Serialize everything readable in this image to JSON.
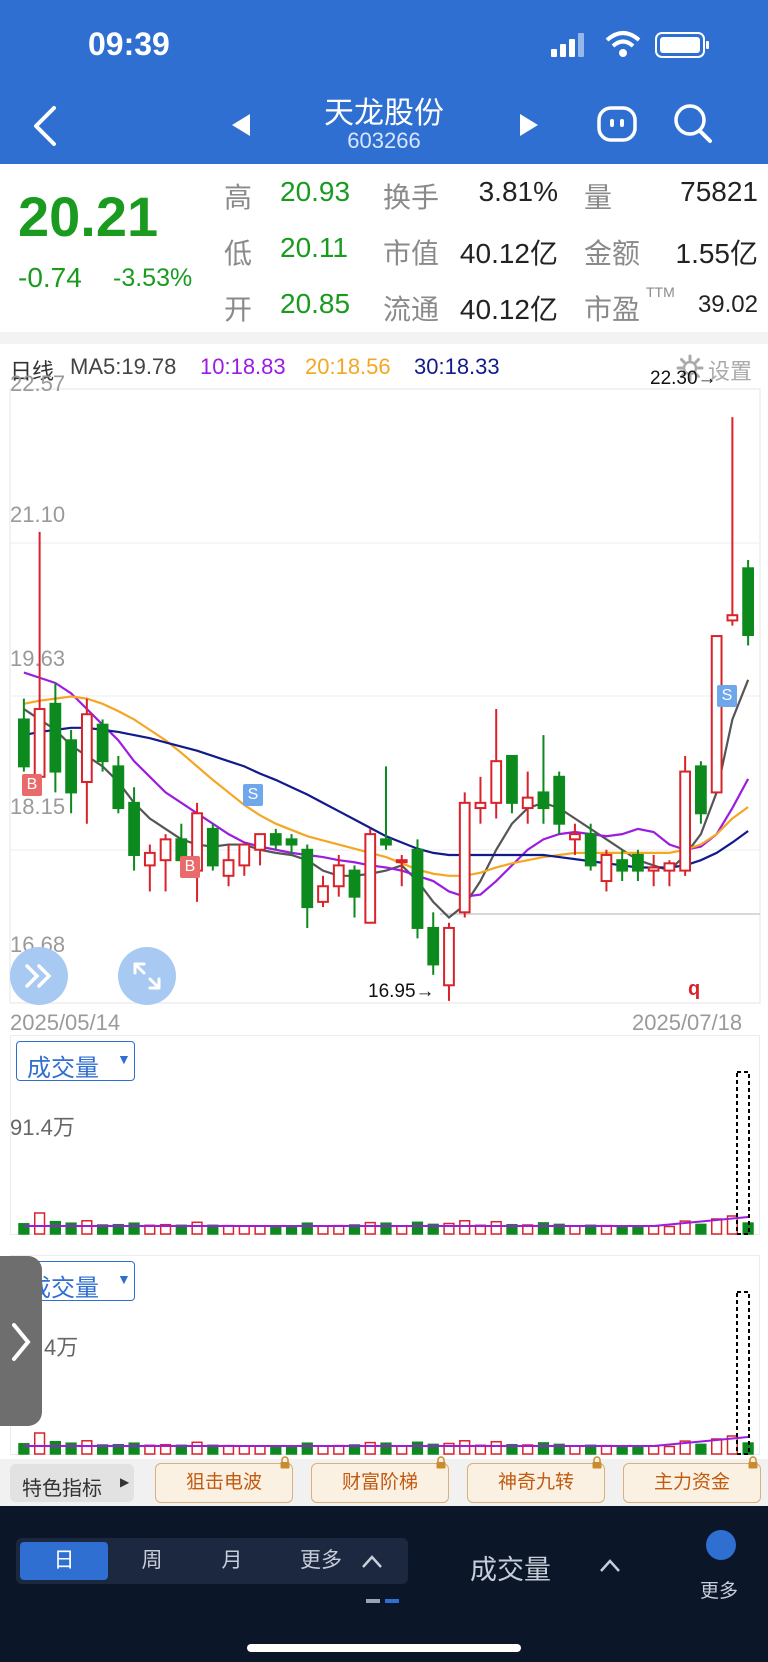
{
  "status": {
    "time": "09:39"
  },
  "nav": {
    "title": "天龙股份",
    "code": "603266"
  },
  "quote": {
    "price": "20.21",
    "change": "-0.74",
    "change_pct": "-3.53%",
    "labels": {
      "high": "高",
      "low": "低",
      "open": "开",
      "turnover": "换手",
      "mkt_cap": "市值",
      "float_cap": "流通",
      "volume": "量",
      "amount": "金额",
      "pe": "市盈",
      "ttm": "TTM"
    },
    "values": {
      "high": "20.93",
      "low": "20.11",
      "open": "20.85",
      "turnover": "3.81%",
      "mkt_cap": "40.12亿",
      "float_cap": "40.12亿",
      "volume": "75821",
      "amount": "1.55亿",
      "pe": "39.02"
    }
  },
  "kline": {
    "period_label": "日线",
    "ma5": "MA5:19.78",
    "ma10": "10:18.83",
    "ma20": "20:18.56",
    "ma30": "30:18.33",
    "settings": "设置",
    "y_labels": [
      "22.57",
      "21.10",
      "19.63",
      "18.15",
      "16.68"
    ],
    "max_label": "22.30→",
    "min_label": "16.95→",
    "q_marker": "q",
    "date_start": "2025/05/14",
    "date_end": "2025/07/18",
    "colors": {
      "up": "#d9222a",
      "down": "#0c8a1d",
      "ma5": "#555555",
      "ma10": "#9b1de0",
      "ma20": "#f5a623",
      "ma30": "#121a8c"
    },
    "signals": {
      "buy": "B",
      "sell": "S"
    }
  },
  "chart_data": {
    "type": "candlestick",
    "candles": [
      {
        "o": 19.4,
        "h": 19.6,
        "l": 18.9,
        "c": 18.95
      },
      {
        "o": 18.85,
        "h": 21.2,
        "l": 18.7,
        "c": 19.5
      },
      {
        "o": 19.55,
        "h": 19.75,
        "l": 18.7,
        "c": 18.9
      },
      {
        "o": 19.2,
        "h": 19.3,
        "l": 18.5,
        "c": 18.7
      },
      {
        "o": 18.8,
        "h": 19.6,
        "l": 18.4,
        "c": 19.45
      },
      {
        "o": 19.35,
        "h": 19.4,
        "l": 18.9,
        "c": 19.0
      },
      {
        "o": 18.95,
        "h": 19.05,
        "l": 18.5,
        "c": 18.55
      },
      {
        "o": 18.6,
        "h": 18.75,
        "l": 17.95,
        "c": 18.1
      },
      {
        "o": 18.0,
        "h": 18.2,
        "l": 17.75,
        "c": 18.12
      },
      {
        "o": 18.05,
        "h": 18.3,
        "l": 17.75,
        "c": 18.25
      },
      {
        "o": 18.25,
        "h": 18.4,
        "l": 17.95,
        "c": 18.05
      },
      {
        "o": 17.95,
        "h": 18.6,
        "l": 17.65,
        "c": 18.5
      },
      {
        "o": 18.35,
        "h": 18.4,
        "l": 17.95,
        "c": 18.0
      },
      {
        "o": 17.9,
        "h": 18.2,
        "l": 17.8,
        "c": 18.05
      },
      {
        "o": 18.0,
        "h": 18.2,
        "l": 17.9,
        "c": 18.2
      },
      {
        "o": 18.15,
        "h": 18.3,
        "l": 18.0,
        "c": 18.3
      },
      {
        "o": 18.3,
        "h": 18.35,
        "l": 18.15,
        "c": 18.2
      },
      {
        "o": 18.25,
        "h": 18.3,
        "l": 18.1,
        "c": 18.2
      },
      {
        "o": 18.15,
        "h": 18.2,
        "l": 17.4,
        "c": 17.6
      },
      {
        "o": 17.65,
        "h": 17.9,
        "l": 17.6,
        "c": 17.8
      },
      {
        "o": 17.8,
        "h": 18.1,
        "l": 17.7,
        "c": 18.0
      },
      {
        "o": 17.95,
        "h": 18.0,
        "l": 17.5,
        "c": 17.7
      },
      {
        "o": 17.45,
        "h": 18.35,
        "l": 17.45,
        "c": 18.3
      },
      {
        "o": 18.25,
        "h": 18.95,
        "l": 18.15,
        "c": 18.2
      },
      {
        "o": 18.05,
        "h": 18.1,
        "l": 17.8,
        "c": 18.05
      },
      {
        "o": 18.15,
        "h": 18.25,
        "l": 17.3,
        "c": 17.4
      },
      {
        "o": 17.4,
        "h": 17.55,
        "l": 16.95,
        "c": 17.05
      },
      {
        "o": 16.85,
        "h": 17.45,
        "l": 16.7,
        "c": 17.4
      },
      {
        "o": 17.55,
        "h": 18.7,
        "l": 17.5,
        "c": 18.6
      },
      {
        "o": 18.55,
        "h": 18.85,
        "l": 18.4,
        "c": 18.6
      },
      {
        "o": 18.6,
        "h": 19.5,
        "l": 18.45,
        "c": 19.0
      },
      {
        "o": 19.05,
        "h": 19.05,
        "l": 18.5,
        "c": 18.6
      },
      {
        "o": 18.55,
        "h": 18.9,
        "l": 18.4,
        "c": 18.65
      },
      {
        "o": 18.7,
        "h": 19.25,
        "l": 18.4,
        "c": 18.55
      },
      {
        "o": 18.85,
        "h": 18.9,
        "l": 18.3,
        "c": 18.4
      },
      {
        "o": 18.25,
        "h": 18.4,
        "l": 18.1,
        "c": 18.3
      },
      {
        "o": 18.3,
        "h": 18.4,
        "l": 17.95,
        "c": 18.0
      },
      {
        "o": 17.85,
        "h": 18.15,
        "l": 17.75,
        "c": 18.1
      },
      {
        "o": 18.05,
        "h": 18.15,
        "l": 17.85,
        "c": 17.95
      },
      {
        "o": 18.1,
        "h": 18.15,
        "l": 17.85,
        "c": 17.95
      },
      {
        "o": 17.95,
        "h": 18.1,
        "l": 17.8,
        "c": 17.98
      },
      {
        "o": 17.95,
        "h": 18.05,
        "l": 17.8,
        "c": 18.02
      },
      {
        "o": 17.95,
        "h": 19.05,
        "l": 17.9,
        "c": 18.9
      },
      {
        "o": 18.95,
        "h": 19.0,
        "l": 18.4,
        "c": 18.5
      },
      {
        "o": 18.7,
        "h": 20.2,
        "l": 18.7,
        "c": 20.2
      },
      {
        "o": 20.35,
        "h": 22.3,
        "l": 20.3,
        "c": 20.4
      },
      {
        "o": 20.85,
        "h": 20.93,
        "l": 20.11,
        "c": 20.21
      }
    ],
    "ma_lines": [
      {
        "name": "MA5",
        "values": [
          19.5,
          19.4,
          19.3,
          19.15,
          19.05,
          18.95,
          18.8,
          18.6,
          18.45,
          18.35,
          18.25,
          18.2,
          18.18,
          18.2,
          18.2,
          18.15,
          18.12,
          18.1,
          18.05,
          17.95,
          17.9,
          17.9,
          17.92,
          17.95,
          18.0,
          17.85,
          17.65,
          17.5,
          17.62,
          17.85,
          18.15,
          18.4,
          18.55,
          18.6,
          18.55,
          18.45,
          18.35,
          18.25,
          18.15,
          18.05,
          18.0,
          17.95,
          18.1,
          18.3,
          18.7,
          19.4,
          19.78
        ]
      },
      {
        "name": "MA10",
        "values": [
          19.85,
          19.8,
          19.75,
          19.65,
          19.5,
          19.35,
          19.2,
          19.0,
          18.85,
          18.7,
          18.6,
          18.5,
          18.4,
          18.3,
          18.22,
          18.18,
          18.15,
          18.12,
          18.1,
          18.08,
          18.05,
          18.03,
          18.0,
          17.98,
          17.95,
          17.9,
          17.85,
          17.75,
          17.7,
          17.72,
          17.85,
          18.0,
          18.15,
          18.25,
          18.3,
          18.32,
          18.3,
          18.28,
          18.3,
          18.35,
          18.32,
          18.2,
          18.15,
          18.18,
          18.3,
          18.55,
          18.83
        ]
      },
      {
        "name": "MA20",
        "values": [
          19.55,
          19.58,
          19.6,
          19.62,
          19.6,
          19.55,
          19.48,
          19.4,
          19.3,
          19.2,
          19.08,
          18.95,
          18.82,
          18.7,
          18.58,
          18.48,
          18.4,
          18.34,
          18.28,
          18.24,
          18.2,
          18.16,
          18.12,
          18.08,
          18.02,
          17.96,
          17.92,
          17.9,
          17.9,
          17.93,
          17.98,
          18.02,
          18.05,
          18.08,
          18.1,
          18.12,
          18.12,
          18.12,
          18.12,
          18.12,
          18.12,
          18.12,
          18.15,
          18.2,
          18.3,
          18.45,
          18.56
        ]
      },
      {
        "name": "MA30",
        "values": [
          19.25,
          19.28,
          19.3,
          19.32,
          19.32,
          19.3,
          19.28,
          19.25,
          19.22,
          19.18,
          19.14,
          19.1,
          19.05,
          19.0,
          18.95,
          18.88,
          18.82,
          18.75,
          18.68,
          18.6,
          18.52,
          18.44,
          18.36,
          18.28,
          18.22,
          18.16,
          18.12,
          18.1,
          18.1,
          18.1,
          18.1,
          18.1,
          18.1,
          18.1,
          18.08,
          18.06,
          18.04,
          18.02,
          18.0,
          17.98,
          17.98,
          17.98,
          18.0,
          18.05,
          18.12,
          18.22,
          18.33
        ]
      }
    ],
    "y_range": [
      16.68,
      22.57
    ]
  },
  "volume1": {
    "label": "成交量",
    "y_label": "91.4万"
  },
  "volume2": {
    "label": "成交量",
    "y_label": "4万"
  },
  "indicator_tabs": {
    "lead": "特色指标",
    "items": [
      "狙击电波",
      "财富阶梯",
      "神奇九转",
      "主力资金"
    ]
  },
  "bottom": {
    "periods": [
      "日",
      "周",
      "月",
      "更多"
    ],
    "indicator": "成交量",
    "more": "更多"
  }
}
